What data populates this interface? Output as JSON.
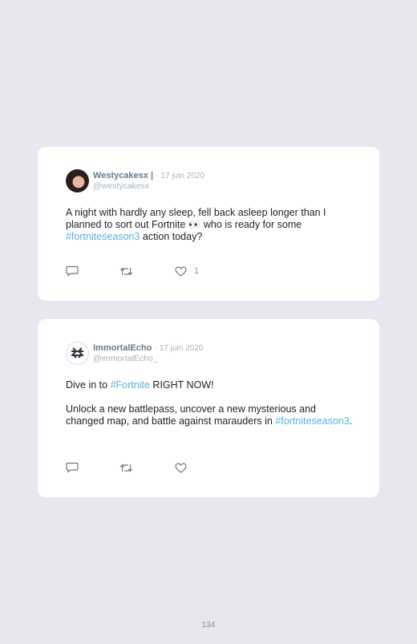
{
  "tweets": [
    {
      "author_name": "Westycakesx",
      "name_suffix": "|",
      "date": "17 juin 2020",
      "handle": "@westycakesx",
      "text_before": "A night with hardly any sleep, fell back asleep longer than I planned to sort out Fortnite 👀 who is ready for some ",
      "hashtag": "#fortniteseason3",
      "text_after": " action today?",
      "like_count": "1"
    },
    {
      "author_name": "ImmortalEcho",
      "date": "17 juin 2020",
      "handle": "@immortalEcho_",
      "line1_before": "Dive in to ",
      "line1_hashtag": "#Fortnite",
      "line1_after": " RIGHT NOW!",
      "para2_before": "Unlock a new battlepass, uncover a new mysterious and changed map, and battle against marauders in ",
      "para2_hashtag": "#fortniteseason3",
      "para2_after": "."
    }
  ],
  "icons": {
    "reply": "speech-bubble-icon",
    "retweet": "retweet-arrows-icon",
    "like": "heart-icon"
  },
  "colors": {
    "page_background": "#e9e5f1",
    "card_background": "#ffffff",
    "hashtag": "#5bb1e2",
    "name": "#687a8b",
    "muted": "#a6b2bd"
  },
  "page_number": "134"
}
